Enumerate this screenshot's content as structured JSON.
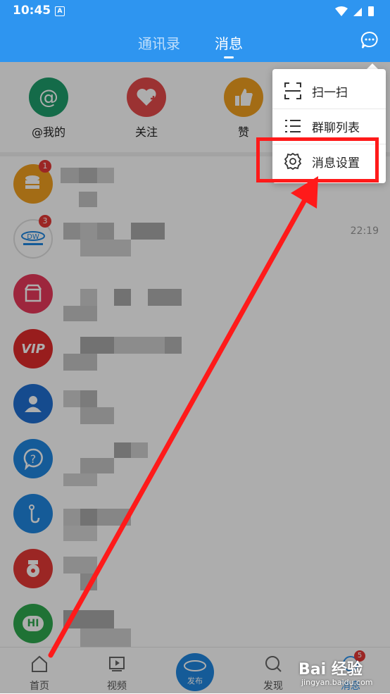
{
  "status": {
    "time": "10:45",
    "notify_letter": "A"
  },
  "header": {
    "tabs": [
      {
        "label": "通讯录"
      },
      {
        "label": "消息"
      }
    ]
  },
  "quick_actions": [
    {
      "label": "@我的",
      "color": "#1e9e6c"
    },
    {
      "label": "关注",
      "color": "#e54a4a"
    },
    {
      "label": "赞",
      "color": "#f0a020"
    }
  ],
  "conversations": [
    {
      "badge": "1",
      "color": "#f0a020",
      "time": ""
    },
    {
      "badge": "3",
      "color": "#ffffff",
      "time": "22:19"
    },
    {
      "badge": "",
      "color": "#e8395a",
      "time": ""
    },
    {
      "badge": "",
      "color": "#e12b2b",
      "time": ""
    },
    {
      "badge": "",
      "color": "#1f6fd1",
      "time": ""
    },
    {
      "badge": "",
      "color": "#1f86e0",
      "time": ""
    },
    {
      "badge": "",
      "color": "#1f86e0",
      "time": ""
    },
    {
      "badge": "",
      "color": "#e53935",
      "time": ""
    },
    {
      "badge": "",
      "color": "#2fa84f",
      "time": ""
    }
  ],
  "avatar_texts": {
    "vip": "VIP",
    "hi": "HI"
  },
  "dropdown": {
    "items": [
      {
        "label": "扫一扫"
      },
      {
        "label": "群聊列表"
      },
      {
        "label": "消息设置"
      }
    ]
  },
  "tabbar": {
    "items": [
      {
        "label": "首页"
      },
      {
        "label": "视频"
      },
      {
        "label": "发布"
      },
      {
        "label": "发现"
      },
      {
        "label": "消息"
      }
    ],
    "message_badge": "5"
  },
  "watermark": {
    "main": "Bai 经验",
    "sub": "jingyan.baidu.com"
  },
  "colors": {
    "accent": "#2e95f0",
    "highlight": "#ff1a1a"
  }
}
